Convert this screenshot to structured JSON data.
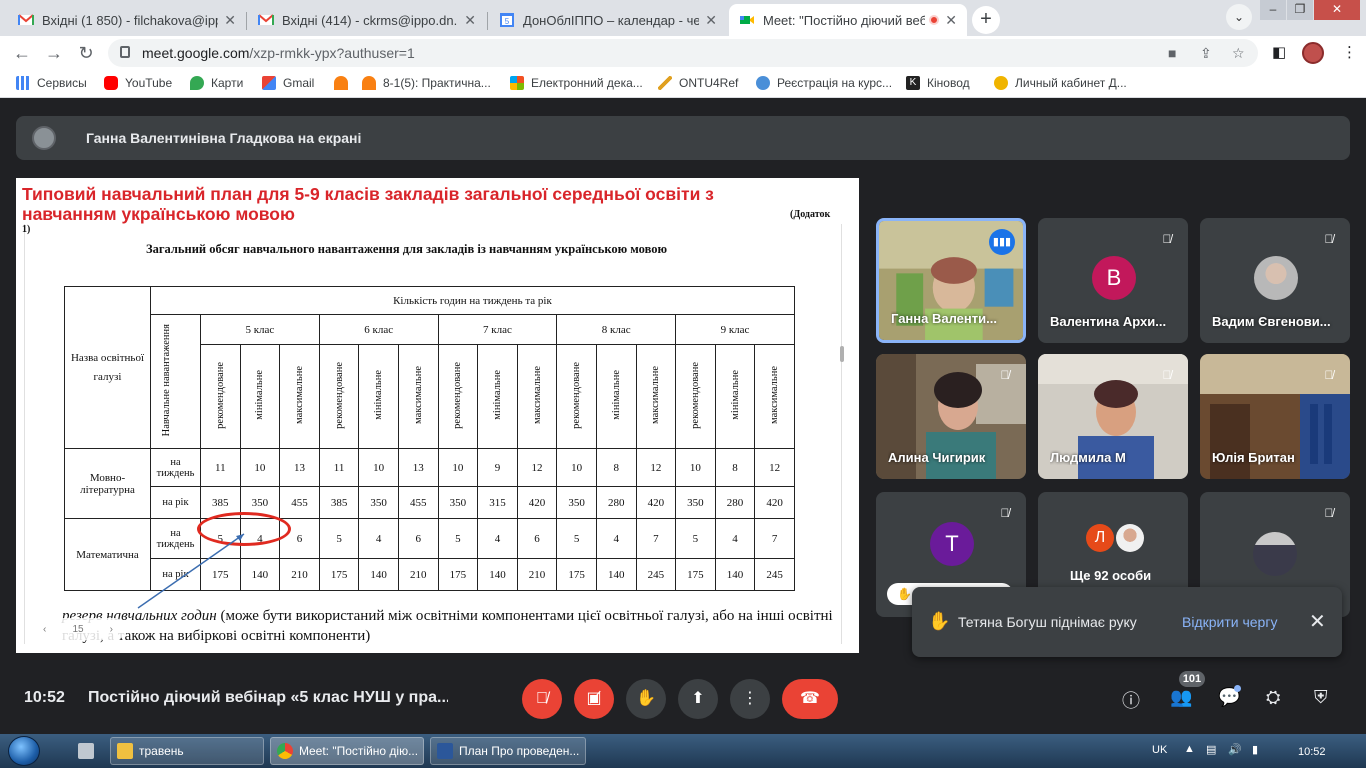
{
  "browser": {
    "tabs": [
      {
        "title": "Вхідні (1 850) - filchakova@ippo..."
      },
      {
        "title": "Вхідні (414) - ckrms@ippo.dn.ua"
      },
      {
        "title": "ДонОблІППО – календар - четв..."
      },
      {
        "title": "Meet: \"Постійно діючий веб"
      }
    ],
    "url_host": "meet.google.com",
    "url_path": "/xzp-rmkk-ypx?authuser=1",
    "bookmarks": [
      {
        "label": "Сервисы"
      },
      {
        "label": "YouTube"
      },
      {
        "label": "Карти"
      },
      {
        "label": "Gmail"
      },
      {
        "label": ""
      },
      {
        "label": "8-1(5): Практична..."
      },
      {
        "label": "Електронний дека..."
      },
      {
        "label": "ONTU4Ref"
      },
      {
        "label": "Реєстрація на курс..."
      },
      {
        "label": "Кіновод"
      },
      {
        "label": "Личный кабинет Д..."
      }
    ]
  },
  "meet": {
    "presenter_text": "Ганна Валентинівна Гладкова на екрані",
    "clock": "10:52",
    "meeting_title": "Постійно діючий вебінар «5 клас НУШ у пра...",
    "participants_count": "101",
    "toast": {
      "message": "Тетяна Богуш піднімає руку",
      "action": "Відкрити чергу"
    },
    "tiles": [
      {
        "name": "Ганна Валенти..."
      },
      {
        "name": "Валентина Архи...",
        "initial": "В"
      },
      {
        "name": "Вадим Євгенови..."
      },
      {
        "name": "Алина Чигирик"
      },
      {
        "name": "Людмила М"
      },
      {
        "name": "Юлія Британ"
      },
      {
        "name": "",
        "initial": "T"
      },
      {
        "name": "Ще 92 особи",
        "initial": "Л"
      },
      {
        "name": ""
      }
    ]
  },
  "document": {
    "title": "Типовий навчальний план для 5-9 класів закладів загальної середньої освіти з навчанням українською мовою",
    "annex": "(Додаток",
    "annex2": "1)",
    "subtitle": "Загальний обсяг навчального навантаження для закладів із навчанням українською мовою",
    "header_group": "Кількість годин на тиждень та рік",
    "col_area": "Назва освітньої галузі",
    "col_load": "Навчальне навантаження",
    "grades": [
      "5 клас",
      "6 клас",
      "7 клас",
      "8 клас",
      "9 клас"
    ],
    "subcols": [
      "рекомендоване",
      "мінімальне",
      "максимальне"
    ],
    "rows": [
      {
        "area": "Мовно-літературна",
        "period": "на тиждень",
        "values": [
          "11",
          "10",
          "13",
          "11",
          "10",
          "13",
          "10",
          "9",
          "12",
          "10",
          "8",
          "12",
          "10",
          "8",
          "12"
        ]
      },
      {
        "area": "",
        "period": "на рік",
        "values": [
          "385",
          "350",
          "455",
          "385",
          "350",
          "455",
          "350",
          "315",
          "420",
          "350",
          "280",
          "420",
          "350",
          "280",
          "420"
        ]
      },
      {
        "area": "Математична",
        "period": "на тиждень",
        "values": [
          "5",
          "4",
          "6",
          "5",
          "4",
          "6",
          "5",
          "4",
          "6",
          "5",
          "4",
          "7",
          "5",
          "4",
          "7"
        ]
      },
      {
        "area": "",
        "period": "на рік",
        "values": [
          "175",
          "140",
          "210",
          "175",
          "140",
          "210",
          "175",
          "140",
          "210",
          "175",
          "140",
          "245",
          "175",
          "140",
          "245"
        ]
      }
    ],
    "footnote_italic": "резерв навчальних годин",
    "footnote_rest": " (може бути використаний між освітніми компонентами цієї освітньої галузі, або на інші освітні галузі, а також на вибіркові освітні компоненти)",
    "pager": "15"
  },
  "taskbar": {
    "items": [
      {
        "label": "травень"
      },
      {
        "label": "Meet: \"Постійно дію..."
      },
      {
        "label": "План Про проведен..."
      }
    ],
    "lang": "UK",
    "time": "10:52"
  },
  "colors": {
    "meet_bg": "#202124",
    "tile_bg": "#3c4043",
    "hangup_red": "#ea4335",
    "accent_blue": "#8ab4f8",
    "doc_title_red": "#d9252a"
  }
}
